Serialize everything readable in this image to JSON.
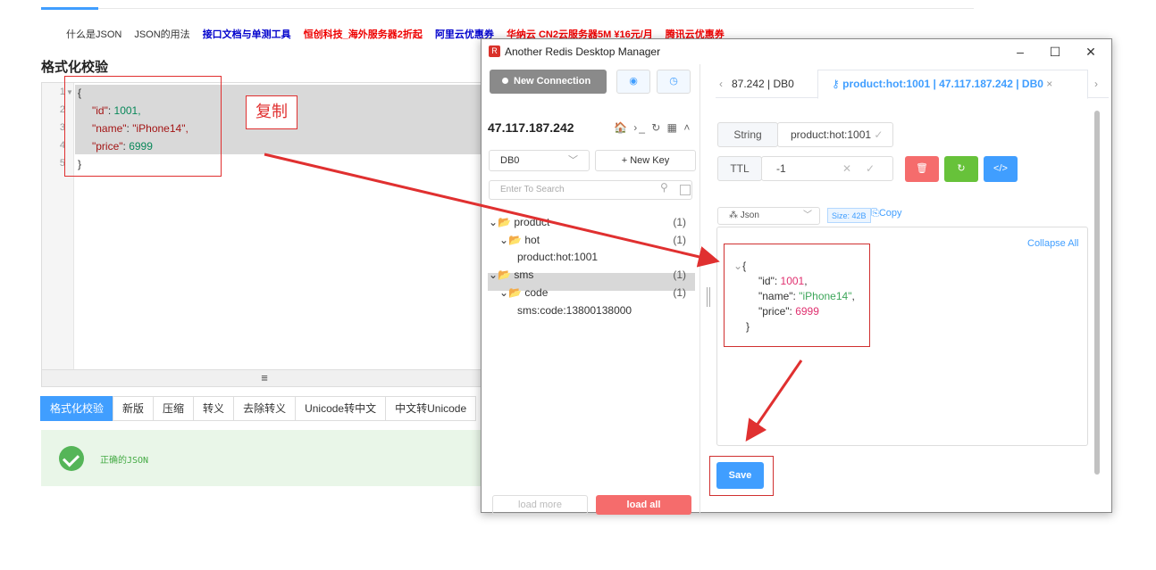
{
  "site": {
    "links": [
      {
        "label": "什么是JSON",
        "style": "dark"
      },
      {
        "label": "JSON的用法",
        "style": "dark"
      },
      {
        "label": "接口文档与单测工具",
        "style": "blue"
      },
      {
        "label": "恒创科技_海外服务器2折起",
        "style": "red"
      },
      {
        "label": "阿里云优惠券",
        "style": "blue"
      },
      {
        "label": "华纳云 CN2云服务器5M ¥16元/月",
        "style": "red"
      },
      {
        "label": "腾讯云优惠券",
        "style": "red"
      }
    ],
    "title": "格式化校验",
    "editor_lines": [
      "1",
      "2",
      "3",
      "4",
      "5"
    ],
    "editor_code": {
      "l1": "{",
      "l2k": "\"id\"",
      "l2v": " 1001,",
      "l3k": "\"name\"",
      "l3v": " \"iPhone14\",",
      "l4k": "\"price\"",
      "l4v": " 6999",
      "l5": "}"
    },
    "resize_glyph": "≡",
    "tabs": [
      "格式化校验",
      "新版",
      "压缩",
      "转义",
      "去除转义",
      "Unicode转中文",
      "中文转Unicode"
    ],
    "status": "正确的JSON",
    "annotation": "复制"
  },
  "window": {
    "title": "Another Redis Desktop Manager",
    "app_icon_letter": "R",
    "controls": {
      "minimize": "–",
      "maximize": "☐",
      "close": "✕"
    },
    "new_connection": "New Connection",
    "host": "47.117.187.242",
    "host_icons": "🏠 ›_ ↻ ▦ ˄",
    "db_select": "DB0",
    "new_key": "+ New Key",
    "search_placeholder": "Enter To Search",
    "tree": [
      {
        "label": "product",
        "count": "(1)",
        "level": 0,
        "type": "folder"
      },
      {
        "label": "hot",
        "count": "(1)",
        "level": 1,
        "type": "folder"
      },
      {
        "label": "product:hot:1001",
        "count": "",
        "level": 2,
        "type": "key"
      },
      {
        "label": "sms",
        "count": "(1)",
        "level": 0,
        "type": "folder"
      },
      {
        "label": "code",
        "count": "(1)",
        "level": 1,
        "type": "folder"
      },
      {
        "label": "sms:code:13800138000",
        "count": "",
        "level": 2,
        "type": "key"
      }
    ],
    "load_more": "load more",
    "load_all": "load all",
    "tab_prev": "87.242 | DB0",
    "tab_active": "product:hot:1001 | 47.117.187.242 | DB0",
    "type_label": "String",
    "key_name": "product:hot:1001",
    "ttl_label": "TTL",
    "ttl_value": "-1",
    "view_mode": "Json",
    "size_badge": "Size: 42B",
    "copy_label": "Copy",
    "collapse_all": "Collapse All",
    "json_value": {
      "open": "{",
      "id_k": "\"id\": ",
      "id_v": "1001",
      "name_k": "\"name\": ",
      "name_v": "\"iPhone14\"",
      "price_k": "\"price\": ",
      "price_v": "6999",
      "close": "}"
    },
    "save": "Save"
  },
  "colors": {
    "accent": "#409eff",
    "danger": "#f56c6c",
    "success": "#67c23a",
    "annotation": "#e03030"
  }
}
